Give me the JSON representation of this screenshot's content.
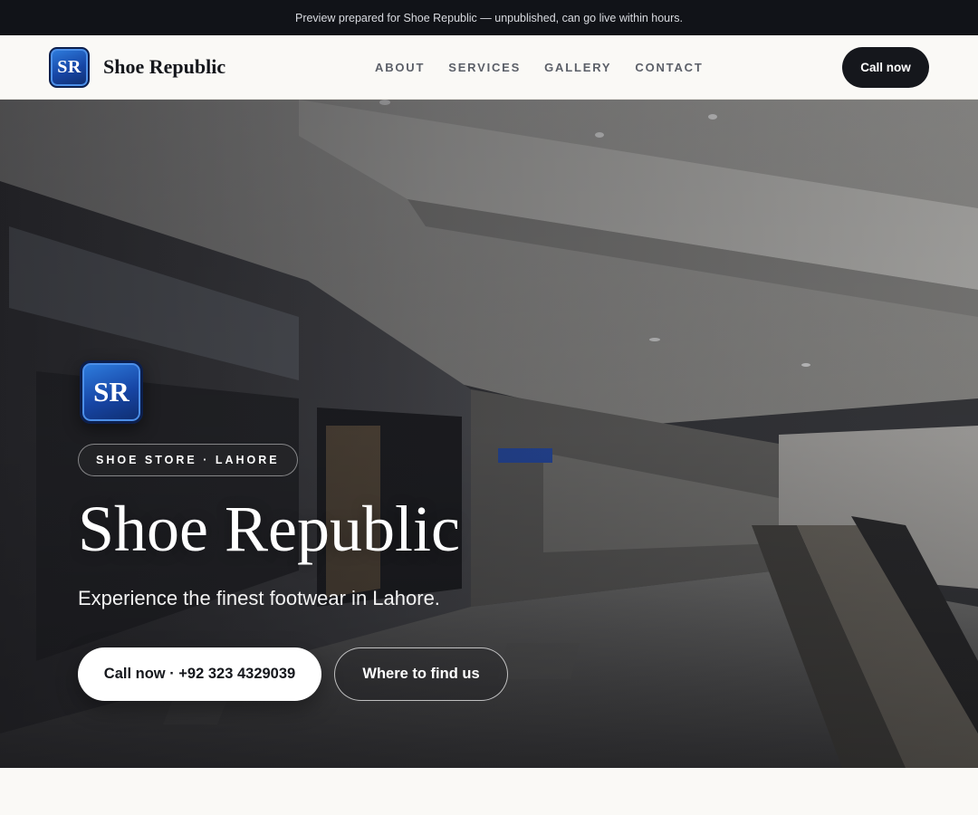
{
  "preview_banner": {
    "text": "Preview prepared for Shoe Republic — unpublished, can go live within hours."
  },
  "header": {
    "logo_text": "SR",
    "brand_name": "Shoe Republic",
    "nav": [
      {
        "label": "ABOUT"
      },
      {
        "label": "SERVICES"
      },
      {
        "label": "GALLERY"
      },
      {
        "label": "CONTACT"
      }
    ],
    "cta_label": "Call now"
  },
  "hero": {
    "logo_text": "SR",
    "tag": "SHOE STORE · LAHORE",
    "title": "Shoe Republic",
    "subtitle": "Experience the finest footwear in Lahore.",
    "primary_button": "Call now · +92 323 4329039",
    "secondary_button": "Where to find us",
    "background_image": "shopping-mall-interior"
  },
  "colors": {
    "banner_bg": "#111318",
    "page_bg": "#faf9f6",
    "dark_button": "#15171c",
    "logo_blue": "#1746a6"
  }
}
